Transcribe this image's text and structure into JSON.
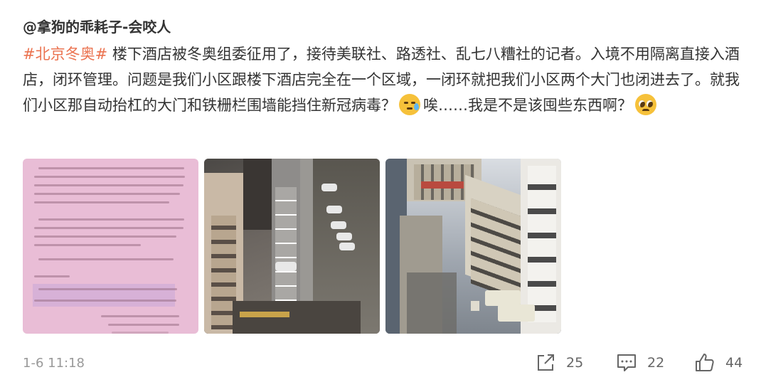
{
  "post": {
    "author": "@拿狗的乖耗子-会咬人",
    "topic": "#北京冬奥#",
    "text_1": " 楼下酒店被冬奥组委征用了，接待美联社、路透社、乱七八糟社的记者。入境不用隔离直接入酒店，闭环管理。问题是我们小区跟楼下酒店完全在一个区域，一闭环就把我们小区两个大门也闭进去了。就我们小区那自动抬杠的大门和铁栅栏围墙能挡住新冠病毒？",
    "emoji_1": "sweat-emoji",
    "text_2": "唉……我是不是该囤些东西啊？",
    "emoji_2": "pleading-emoji",
    "time": "1-6 11:18"
  },
  "images": [
    {
      "name": "notice-photo"
    },
    {
      "name": "hotel-street-photo"
    },
    {
      "name": "hotel-courtyard-photo"
    }
  ],
  "actions": {
    "share_icon": "share-icon",
    "share_count": "25",
    "comment_icon": "comment-icon",
    "comment_count": "22",
    "like_icon": "thumbs-up-icon",
    "like_count": "44"
  },
  "colors": {
    "topic": "#eb7350",
    "text": "#333333",
    "meta": "#999999"
  }
}
